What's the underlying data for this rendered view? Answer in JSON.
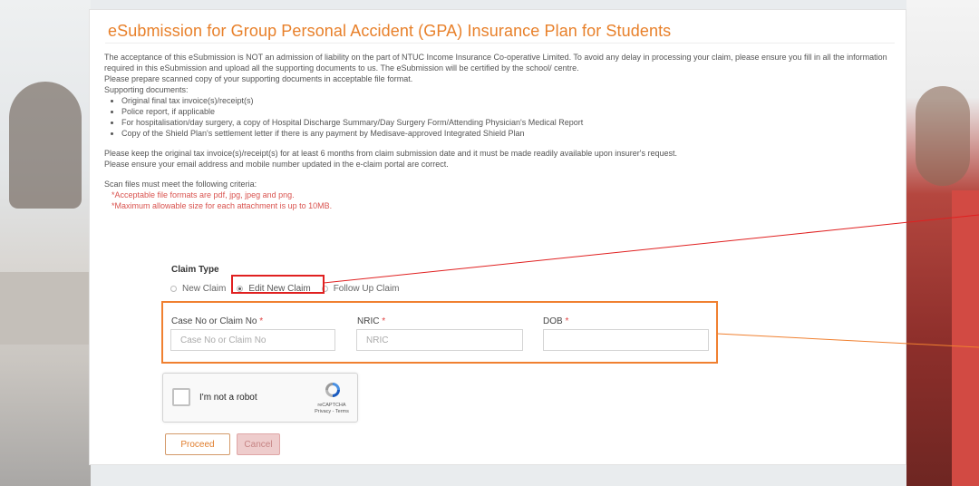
{
  "page": {
    "title": "eSubmission for Group Personal Accident (GPA) Insurance Plan for Students"
  },
  "intro": {
    "p1": "The acceptance of this eSubmission is NOT an admission of liability on the part of NTUC Income Insurance Co-operative Limited. To avoid any delay in processing your claim, please ensure you fill in all the information required in this eSubmission and upload all the supporting documents to us. The eSubmission will be certified by the school/ centre.",
    "p2": "Please prepare scanned copy of your supporting documents in acceptable file format.",
    "p3": "Supporting documents:",
    "docs": [
      "Original final tax invoice(s)/receipt(s)",
      "Police report, if applicable",
      "For hospitalisation/day surgery, a copy of Hospital Discharge Summary/Day Surgery Form/Attending Physician's Medical Report",
      "Copy of the Shield Plan's settlement letter if there is any payment by Medisave-approved Integrated Shield Plan"
    ],
    "p4": "Please keep the original tax invoice(s)/receipt(s) for at least 6 months from claim submission date and it must be made readily available upon insurer's request.",
    "p5": "Please ensure your email address and mobile number updated in the e-claim portal are correct.",
    "p6": "Scan files must meet the following criteria:",
    "criteria": [
      "*Acceptable file formats are pdf, jpg, jpeg and png.",
      "*Maximum allowable size for each attachment is up to 10MB."
    ]
  },
  "claim_type": {
    "label": "Claim Type",
    "options": [
      "New Claim",
      "Edit New Claim",
      "Follow Up Claim"
    ],
    "selected": "Edit New Claim"
  },
  "fields": {
    "case_no": {
      "label": "Case No or Claim No",
      "required": "*",
      "placeholder": "Case No or Claim No",
      "value": ""
    },
    "nric": {
      "label": "NRIC",
      "required": "*",
      "placeholder": "NRIC",
      "value": ""
    },
    "dob": {
      "label": "DOB",
      "required": "*",
      "placeholder": "",
      "value": ""
    }
  },
  "captcha": {
    "label": "I'm not a robot",
    "brand": "reCAPTCHA",
    "links": "Privacy - Terms"
  },
  "buttons": {
    "proceed": "Proceed",
    "cancel": "Cancel"
  },
  "colors": {
    "title": "#e8802a",
    "highlight_red": "#e02020",
    "highlight_orange": "#f08030",
    "criteria_text": "#d9534f"
  }
}
